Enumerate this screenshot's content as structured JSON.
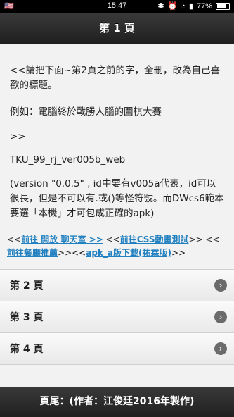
{
  "status": {
    "left": "🇺🇸",
    "time": "15:47",
    "right_icons": [
      "bluetooth-icon",
      "alarm-icon",
      "wifi-icon",
      "signal-icon"
    ],
    "battery_percent": "77%"
  },
  "header": {
    "title": "第 1 頁"
  },
  "content": {
    "p1": "<<請把下面~第2頁之前的字，全刪，改為自己喜歡的標題。",
    "p2": "例如：電腦終於戰勝人腦的圍棋大賽",
    "p3": ">>",
    "p4": "TKU_99_rj_ver005b_web",
    "p5": "(version \"0.0.5\" , id中要有v005a代表，id可以很長，但是不可以有.或()等怪符號。而DWcs6範本要選「本機」才可包成正確的apk)"
  },
  "links": {
    "prefix1": "<<",
    "link1": "前往 開放 聊天室 >>",
    "sep1": " <<",
    "link2": "前往CSS動畫測試",
    "sep2": ">> <<",
    "link3": "前往餐廳推薦",
    "sep3": ">><<",
    "link4": "apk_a版下載(祐霖版)",
    "suffix": ">>"
  },
  "list": [
    {
      "label": "第 2 頁"
    },
    {
      "label": "第 3 頁"
    },
    {
      "label": "第 4 頁"
    }
  ],
  "footer": {
    "text": "頁尾：(作者：江俊廷2016年製作)"
  }
}
